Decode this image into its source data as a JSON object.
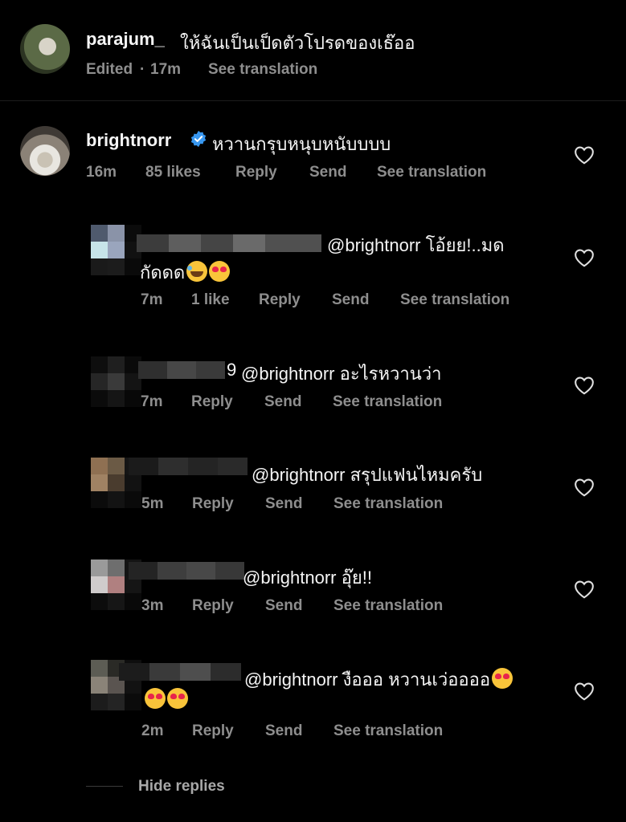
{
  "top_comment": {
    "username": "parajum_",
    "text": "ให้ฉันเป็นเป็ดตัวโปรดของเธ๊ออ",
    "edited": "Edited",
    "dot": "·",
    "time": "17m",
    "see_translation": "See translation"
  },
  "main_comment": {
    "username": "brightnorr",
    "text": "หวานกรุบหนุบหนับบบบ",
    "time": "16m",
    "likes": "85 likes",
    "reply": "Reply",
    "send": "Send",
    "see_translation": "See translation"
  },
  "replies": [
    {
      "text_line1": "@brightnorr โอ้ยย!..มด",
      "text_line2": "กัดดด",
      "emojis": [
        "face-with-tears-of-joy",
        "smiling-face-with-heart-eyes"
      ],
      "time": "7m",
      "likes": "1 like",
      "reply": "Reply",
      "send": "Send",
      "see_translation": "See translation"
    },
    {
      "name_fragment": "9",
      "text_line1": "@brightnorr อะไรหวานว่า",
      "time": "7m",
      "reply": "Reply",
      "send": "Send",
      "see_translation": "See translation"
    },
    {
      "text_line1": "@brightnorr สรุปแฟนไหมครับ",
      "time": "5m",
      "reply": "Reply",
      "send": "Send",
      "see_translation": "See translation"
    },
    {
      "text_line1": "@brightnorr  อุ๊ย!!",
      "time": "3m",
      "reply": "Reply",
      "send": "Send",
      "see_translation": "See translation"
    },
    {
      "text_line1": "@brightnorr งือออ หวานเว่ออออ",
      "emojis": [
        "smiling-face-with-heart-eyes",
        "smiling-face-with-heart-eyes",
        "smiling-face-with-heart-eyes"
      ],
      "time": "2m",
      "reply": "Reply",
      "send": "Send",
      "see_translation": "See translation"
    }
  ],
  "hide_replies": "Hide replies",
  "icons": {
    "like": "heart-outline-icon",
    "verified": "verified-badge-icon"
  },
  "colors": {
    "background": "#000000",
    "primary_text": "#f5f5f5",
    "secondary_text": "#8e8e8e",
    "verified_blue": "#3897f0"
  }
}
